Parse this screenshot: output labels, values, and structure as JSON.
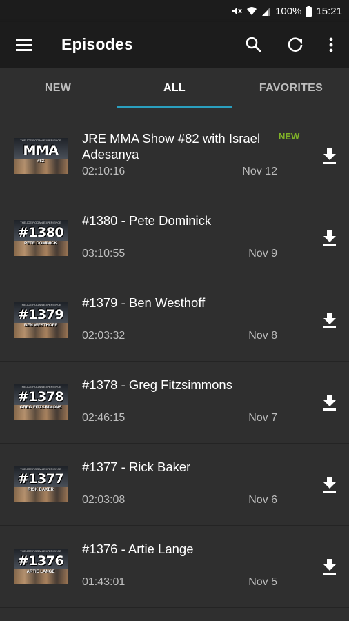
{
  "status": {
    "battery": "100%",
    "time": "15:21"
  },
  "appbar": {
    "title": "Episodes",
    "icons": [
      "menu-icon",
      "search-icon",
      "refresh-icon",
      "more-vert-icon"
    ]
  },
  "tabs": [
    {
      "label": "NEW"
    },
    {
      "label": "ALL",
      "active": true
    },
    {
      "label": "FAVORITES"
    }
  ],
  "episodes": [
    {
      "title": "JRE MMA Show #82 with Israel Adesanya",
      "duration": "02:10:16",
      "date": "Nov 12",
      "badge": "NEW",
      "thumb_text": "MMA",
      "thumb_sub": "#82"
    },
    {
      "title": "#1380 - Pete Dominick",
      "duration": "03:10:55",
      "date": "Nov 9",
      "thumb_text": "#1380",
      "thumb_sub": "PETE DOMINICK"
    },
    {
      "title": "#1379 - Ben Westhoff",
      "duration": "02:03:32",
      "date": "Nov 8",
      "thumb_text": "#1379",
      "thumb_sub": "BEN WESTHOFF"
    },
    {
      "title": "#1378 - Greg Fitzsimmons",
      "duration": "02:46:15",
      "date": "Nov 7",
      "thumb_text": "#1378",
      "thumb_sub": "GREG FITZSIMMONS"
    },
    {
      "title": "#1377 - Rick Baker",
      "duration": "02:03:08",
      "date": "Nov 6",
      "thumb_text": "#1377",
      "thumb_sub": "RICK BAKER"
    },
    {
      "title": "#1376 - Artie Lange",
      "duration": "01:43:01",
      "date": "Nov 5",
      "thumb_text": "#1376",
      "thumb_sub": "ARTIE LANGE"
    }
  ],
  "thumb_header": "THE JOE ROGAN EXPERIENCE",
  "colors": {
    "accent": "#2a9fbf",
    "new_badge": "#7fb127",
    "appbar": "#1c1c1c",
    "background": "#2f2f2f"
  }
}
